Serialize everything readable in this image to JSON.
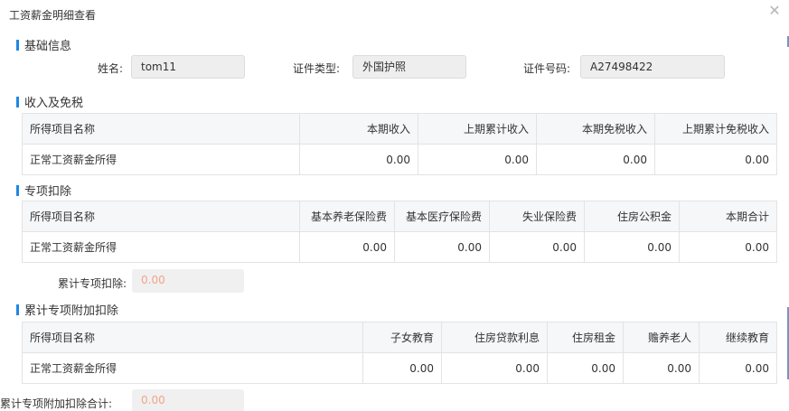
{
  "dialog": {
    "title": "工资薪金明细查看"
  },
  "basic": {
    "section_title": "基础信息",
    "name_label": "姓名:",
    "name_value": "tom11",
    "id_type_label": "证件类型:",
    "id_type_value": "外国护照",
    "id_no_label": "证件号码:",
    "id_no_value": "A27498422"
  },
  "income": {
    "section_title": "收入及免税",
    "headers": [
      "所得项目名称",
      "本期收入",
      "上期累计收入",
      "本期免税收入",
      "上期累计免税收入"
    ],
    "rows": [
      [
        "正常工资薪金所得",
        "0.00",
        "0.00",
        "0.00",
        "0.00"
      ]
    ]
  },
  "special": {
    "section_title": "专项扣除",
    "headers": [
      "所得项目名称",
      "基本养老保险费",
      "基本医疗保险费",
      "失业保险费",
      "住房公积金",
      "本期合计"
    ],
    "rows": [
      [
        "正常工资薪金所得",
        "0.00",
        "0.00",
        "0.00",
        "0.00",
        "0.00"
      ]
    ],
    "total_label": "累计专项扣除:",
    "total_value": "0.00"
  },
  "additional": {
    "section_title": "累计专项附加扣除",
    "headers": [
      "所得项目名称",
      "子女教育",
      "住房贷款利息",
      "住房租金",
      "赡养老人",
      "继续教育"
    ],
    "rows": [
      [
        "正常工资薪金所得",
        "0.00",
        "0.00",
        "0.00",
        "0.00",
        "0.00"
      ]
    ],
    "total_label": "累计专项附加扣除合计:",
    "total_value": "0.00"
  },
  "colors": {
    "accent": "#1e88e5",
    "muted_value": "#f0a58a"
  }
}
